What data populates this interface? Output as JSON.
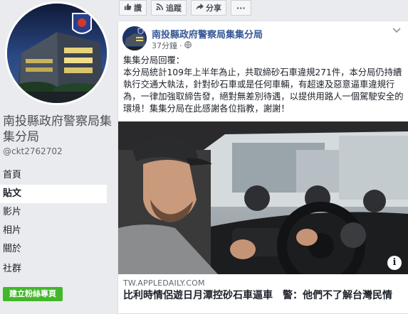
{
  "sidebar": {
    "page_name": "南投縣政府警察局集集分局",
    "handle": "@ckt2762702",
    "nav": [
      {
        "label": "首頁",
        "active": false
      },
      {
        "label": "貼文",
        "active": true
      },
      {
        "label": "影片",
        "active": false
      },
      {
        "label": "相片",
        "active": false
      },
      {
        "label": "關於",
        "active": false
      },
      {
        "label": "社群",
        "active": false
      }
    ],
    "create_page_label": "建立粉絲專頁"
  },
  "actions": {
    "like_label": "讚",
    "follow_label": "追蹤",
    "share_label": "分享",
    "more_label": "···"
  },
  "post": {
    "author": "南投縣政府警察局集集分局",
    "time": "37分鐘",
    "text_heading": "集集分局回覆：",
    "text_body": "本分局統計109年上半年為止，共取締砂石車違規271件，本分局仍持續執行交通大執法，針對砂石車或是任何車輛，有超速及惡意逼車違規行為，一律加強取締告發，絕對無差別待遇，以提供用路人一個駕駛安全的環境！集集分局在此感謝各位指教，謝謝！",
    "link_domain": "TW.APPLEDAILY.COM",
    "link_title": "比利時情侶遊日月潭控砂石車逼車　警：他們不了解台灣民情"
  },
  "icons": {
    "like": "thumbs-up-icon",
    "follow": "rss-icon",
    "share": "share-arrow-icon",
    "globe": "globe-icon",
    "info": "info-icon"
  },
  "colors": {
    "link_blue": "#365899",
    "create_green": "#42b72a",
    "background": "#e9ebee"
  }
}
